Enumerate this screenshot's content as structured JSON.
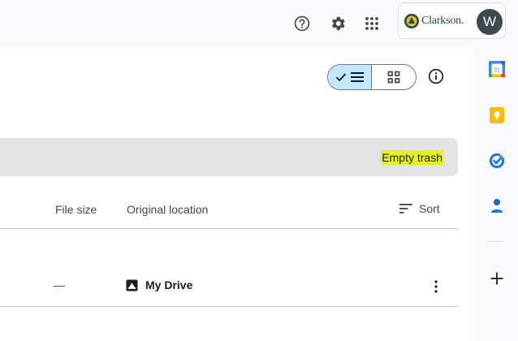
{
  "header": {
    "account": {
      "org_name": "Clarkson.",
      "avatar_initial": "W"
    }
  },
  "icons": {
    "help": "help-icon",
    "settings": "gear-icon",
    "apps": "apps-grid-icon",
    "list_view": "list-view-icon",
    "grid_view": "grid-view-icon",
    "info": "info-icon",
    "sort": "sort-icon",
    "more": "more-vert-icon"
  },
  "banner": {
    "empty_trash_label": "Empty trash"
  },
  "table": {
    "columns": {
      "file_size": "File size",
      "original_location": "Original location",
      "sort": "Sort"
    },
    "rows": [
      {
        "file_size": "—",
        "original_location": "My Drive"
      }
    ]
  },
  "side_panel": {
    "apps": [
      "calendar",
      "keep",
      "tasks",
      "contacts"
    ],
    "calendar_day": "31"
  },
  "colors": {
    "page_bg": "#f8fafd",
    "toggle_active": "#c2e7ff",
    "highlight": "#e8f01e",
    "banner_bg": "#e3e3e3"
  }
}
